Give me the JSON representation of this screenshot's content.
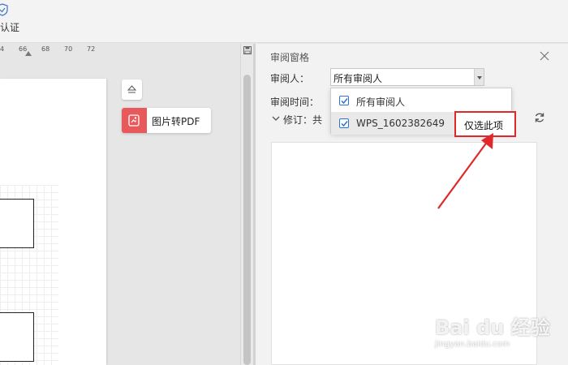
{
  "ribbon": {
    "auth_label": "认证"
  },
  "ruler": {
    "ticks": [
      "4",
      "66",
      "68",
      "70",
      "72"
    ]
  },
  "floating": {
    "pdf_label": "图片转PDF"
  },
  "review_pane": {
    "title": "审阅窗格",
    "reviewer_label": "审阅人：",
    "reviewer_value": "所有审阅人",
    "time_label": "审阅时间：",
    "revision_label": "修订：共"
  },
  "dropdown": {
    "items": [
      {
        "label": "所有审阅人",
        "checked": true
      },
      {
        "label": "WPS_1602382649",
        "checked": true
      }
    ],
    "only_this_label": "仅选此项"
  },
  "colors": {
    "accent": "#2e72d2",
    "highlight": "#e0282a",
    "pdf_icon": "#e8595b"
  },
  "watermark": {
    "logo": "Bai du 经验",
    "url": "jingyan.baidu.com"
  }
}
